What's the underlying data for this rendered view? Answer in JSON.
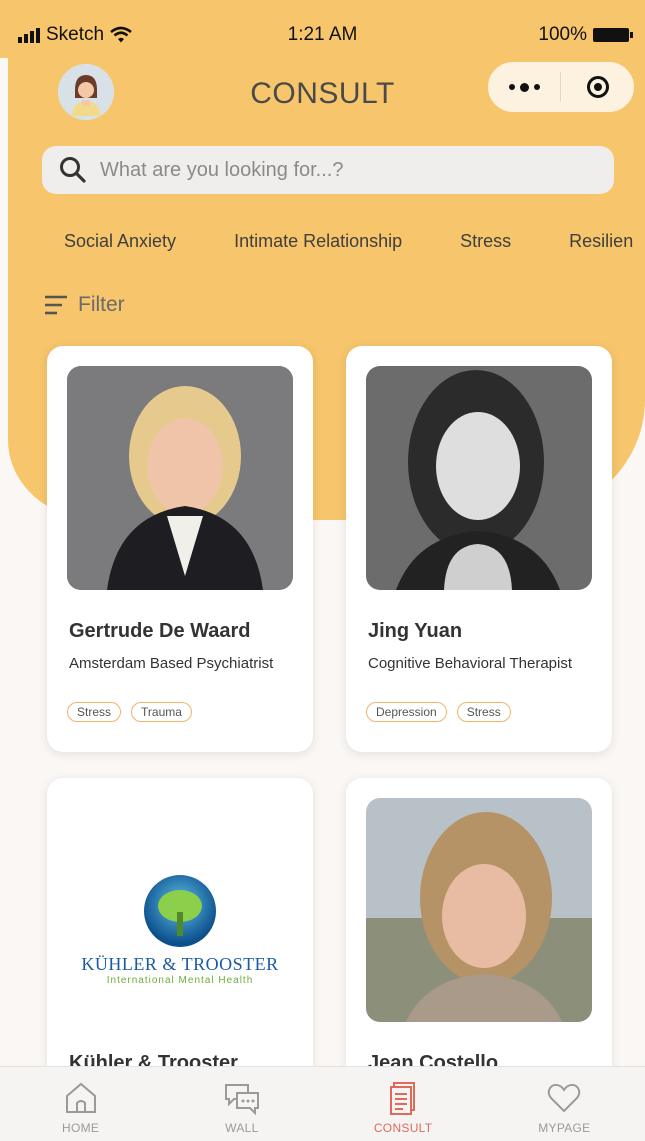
{
  "status_bar": {
    "carrier": "Sketch",
    "time": "1:21 AM",
    "battery": "100%"
  },
  "header": {
    "title": "CONSULT"
  },
  "search": {
    "placeholder": "What are you looking for...?"
  },
  "categories": [
    "Social Anxiety",
    "Intimate Relationship",
    "Stress",
    "Resilien"
  ],
  "filter": {
    "label": "Filter"
  },
  "consultants": [
    {
      "name": "Gertrude De Waard",
      "role": "Amsterdam Based Psychiatrist",
      "tags": [
        "Stress",
        "Trauma"
      ]
    },
    {
      "name": "Jing Yuan",
      "role": "Cognitive Behavioral Therapist",
      "tags": [
        "Depression",
        "Stress"
      ]
    },
    {
      "name": "Kühler & Trooster",
      "logo_line1": "KÜHLER & TROOSTER",
      "logo_line2": "International Mental Health"
    },
    {
      "name": "Jean Costello"
    }
  ],
  "tabbar": [
    {
      "label": "HOME",
      "icon": "home-icon"
    },
    {
      "label": "WALL",
      "icon": "chat-icon"
    },
    {
      "label": "CONSULT",
      "icon": "document-icon",
      "active": true
    },
    {
      "label": "MYPAGE",
      "icon": "heart-icon"
    }
  ],
  "colors": {
    "header_bg": "#f7c56b",
    "tag_border": "#efb46a",
    "active_tab": "#e06a5a",
    "page_bg": "#fbf7f4"
  }
}
